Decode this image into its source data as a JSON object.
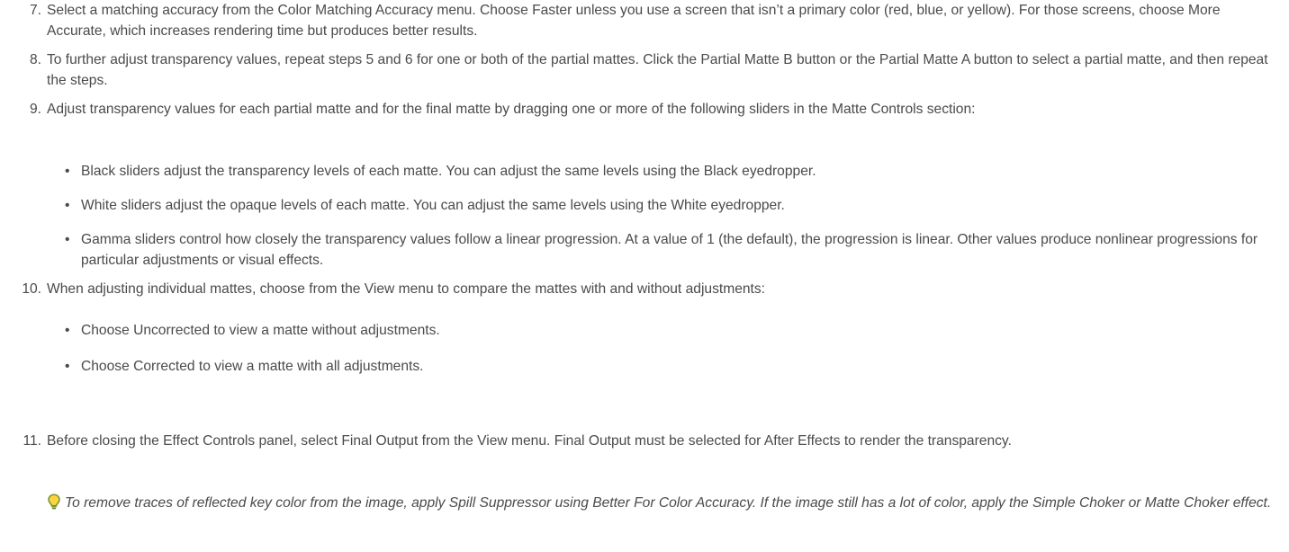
{
  "steps": [
    {
      "number": "7.",
      "text": "Select a matching accuracy from the Color Matching Accuracy menu. Choose Faster unless you use a screen that isn’t a primary color (red, blue, or yellow). For those screens, choose More Accurate, which increases rendering time but produces better results."
    },
    {
      "number": "8.",
      "text": "To further adjust transparency values, repeat steps 5 and 6 for one or both of the partial mattes. Click the Partial Matte B button or the Partial Matte A button to select a partial matte, and then repeat the steps."
    },
    {
      "number": "9.",
      "text": "Adjust transparency values for each partial matte and for the final matte by dragging one or more of the following sliders in the Matte Controls section:",
      "bullets": [
        "Black sliders adjust the transparency levels of each matte. You can adjust the same levels using the Black eyedropper.",
        "White sliders adjust the opaque levels of each matte. You can adjust the same levels using the White eyedropper.",
        "Gamma sliders control how closely the transparency values follow a linear progression. At a value of 1 (the default), the progression is linear. Other values produce nonlinear progressions for particular adjustments or visual effects."
      ]
    },
    {
      "number": "10.",
      "text": "When adjusting individual mattes, choose from the View menu to compare the mattes with and without adjustments:",
      "bullets": [
        "Choose Uncorrected to view a matte without adjustments.",
        "Choose Corrected to view a matte with all adjustments."
      ]
    },
    {
      "number": "11.",
      "text": "Before closing the Effect Controls panel, select Final Output from the View menu. Final Output must be selected for After Effects to render the transparency."
    }
  ],
  "tip": {
    "icon": "lightbulb-icon",
    "text": "To remove traces of reflected key color from the image, apply Spill Suppressor using Better For Color Accuracy. If the image still has a lot of color, apply the Simple Choker or Matte Choker effect."
  },
  "colors": {
    "text": "#4a4a4a",
    "tip_icon_outline": "#6b8e23",
    "tip_icon_fill": "#ffd23f"
  }
}
